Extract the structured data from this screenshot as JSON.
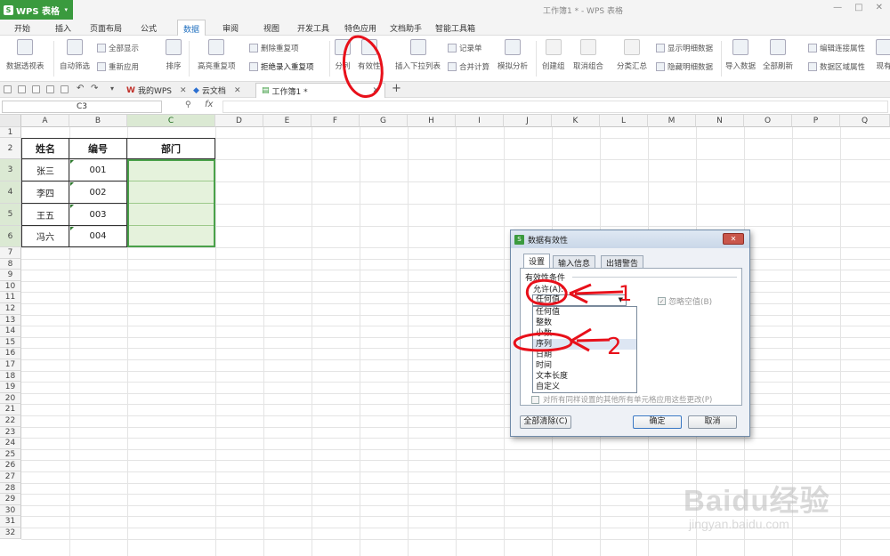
{
  "app": {
    "name": "WPS 表格",
    "logo_letter": "S",
    "doc_title": "工作簿1 * - WPS 表格"
  },
  "window_controls": [
    "—",
    "□",
    "✕"
  ],
  "menu": {
    "items": [
      "开始",
      "插入",
      "页面布局",
      "公式",
      "数据",
      "审阅",
      "视图",
      "开发工具",
      "特色应用",
      "文档助手",
      "智能工具箱"
    ],
    "active": "数据"
  },
  "ribbon": {
    "pivot_table": "数据透视表",
    "auto_filter": "自动筛选",
    "show_all": "全部显示",
    "reapply": "重新应用",
    "sort": "排序",
    "highlight_dup": "高亮重复项",
    "delete_dup": "删除重复项",
    "reject_dup": "拒绝录入重复项",
    "split": "分列",
    "validity": "有效性",
    "insert_dropdown": "插入下拉列表",
    "record_form": "记录单",
    "merge_calc": "合并计算",
    "simulate": "模拟分析",
    "create_group": "创建组",
    "ungroup": "取消组合",
    "subtotal": "分类汇总",
    "show_detail": "显示明细数据",
    "hide_detail": "隐藏明细数据",
    "import_data": "导入数据",
    "refresh_all": "全部刷新",
    "edit_links": "编辑连接属性",
    "range_props": "数据区域属性",
    "existing": "现有"
  },
  "tabs": [
    {
      "label": "我的WPS"
    },
    {
      "label": "云文档"
    },
    {
      "label": "工作簿1 *",
      "active": true
    }
  ],
  "formula_bar": {
    "name_box": "C3",
    "zoom_icon": "⚲",
    "fx": "fx",
    "value": ""
  },
  "columns": [
    "A",
    "B",
    "C",
    "D",
    "E",
    "F",
    "G",
    "H",
    "I",
    "J",
    "K",
    "L",
    "M",
    "N",
    "O",
    "P",
    "Q"
  ],
  "rows": [
    "1",
    "2",
    "3",
    "4",
    "5",
    "6",
    "7",
    "8",
    "9",
    "10",
    "11",
    "12",
    "13",
    "14",
    "15",
    "16",
    "17",
    "18",
    "19",
    "20",
    "21",
    "22",
    "23",
    "24",
    "25",
    "26",
    "27",
    "28",
    "29",
    "30",
    "31",
    "32"
  ],
  "sheet": {
    "headers": [
      "姓名",
      "编号",
      "部门"
    ],
    "data": [
      [
        "张三",
        "001",
        ""
      ],
      [
        "李四",
        "002",
        ""
      ],
      [
        "王五",
        "003",
        ""
      ],
      [
        "冯六",
        "004",
        ""
      ]
    ]
  },
  "dialog": {
    "title": "数据有效性",
    "close": "✕",
    "tabs": [
      "设置",
      "输入信息",
      "出错警告"
    ],
    "condition_label": "有效性条件",
    "allow_label": "允许(A):",
    "allow_value": "任何值",
    "ignore_blank": "忽略空值(B)",
    "options": [
      "任何值",
      "整数",
      "小数",
      "序列",
      "日期",
      "时间",
      "文本长度",
      "自定义"
    ],
    "highlighted_option": "序列",
    "apply_all": "对所有同样设置的其他所有单元格应用这些更改(P)",
    "clear_all": "全部清除(C)",
    "ok": "确定",
    "cancel": "取消"
  },
  "annotations": {
    "label1": "1",
    "label2": "2",
    "color": "#e8101a"
  },
  "watermark": {
    "text": "Baidu经验",
    "url": "jingyan.baidu.com"
  }
}
